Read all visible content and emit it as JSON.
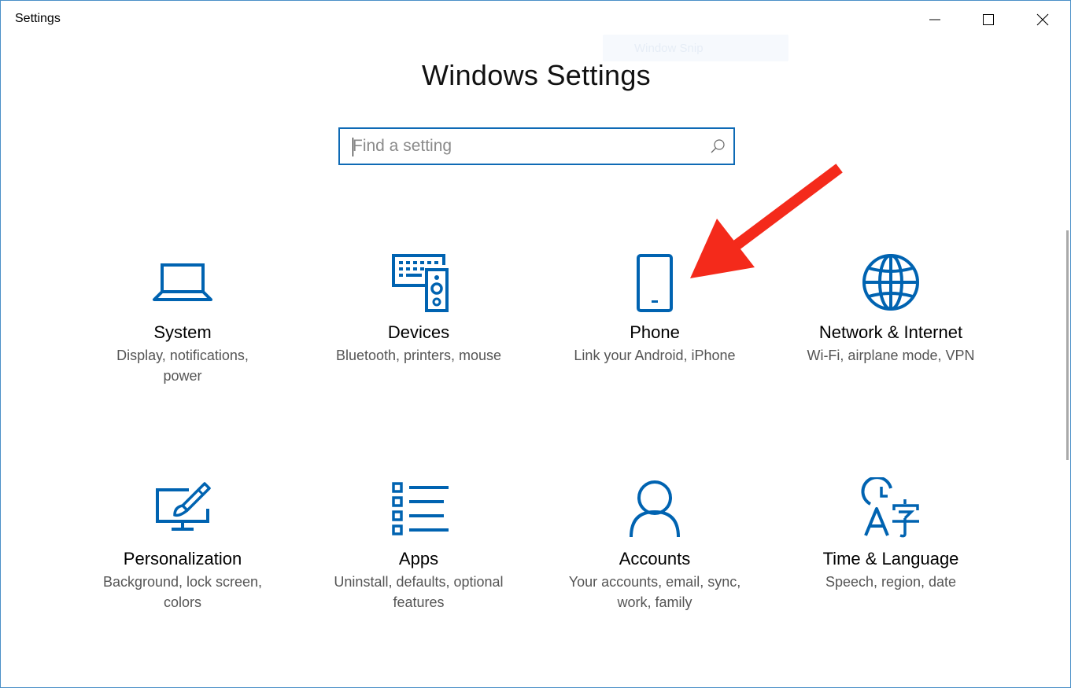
{
  "window": {
    "title": "Settings",
    "controls": {
      "minimize": "minimize",
      "maximize": "maximize",
      "close": "close"
    }
  },
  "ghost_overlay": {
    "label": "Window Snip"
  },
  "header": {
    "title": "Windows Settings"
  },
  "search": {
    "placeholder": "Find a setting",
    "value": ""
  },
  "tiles": [
    {
      "title": "System",
      "description": "Display, notifications, power",
      "icon": "laptop-icon"
    },
    {
      "title": "Devices",
      "description": "Bluetooth, printers, mouse",
      "icon": "keyboard-speaker-icon"
    },
    {
      "title": "Phone",
      "description": "Link your Android, iPhone",
      "icon": "phone-icon"
    },
    {
      "title": "Network & Internet",
      "description": "Wi-Fi, airplane mode, VPN",
      "icon": "globe-icon"
    },
    {
      "title": "Personalization",
      "description": "Background, lock screen, colors",
      "icon": "paint-brush-monitor-icon"
    },
    {
      "title": "Apps",
      "description": "Uninstall, defaults, optional features",
      "icon": "list-icon"
    },
    {
      "title": "Accounts",
      "description": "Your accounts, email, sync, work, family",
      "icon": "person-icon"
    },
    {
      "title": "Time & Language",
      "description": "Speech, region, date",
      "icon": "clock-language-icon"
    }
  ],
  "annotation": {
    "icon": "red-arrow-icon",
    "color": "#f42a1b"
  },
  "colors": {
    "accent": "#0063b1",
    "search_border": "#0e6ab5",
    "window_border": "#4a90c8"
  }
}
